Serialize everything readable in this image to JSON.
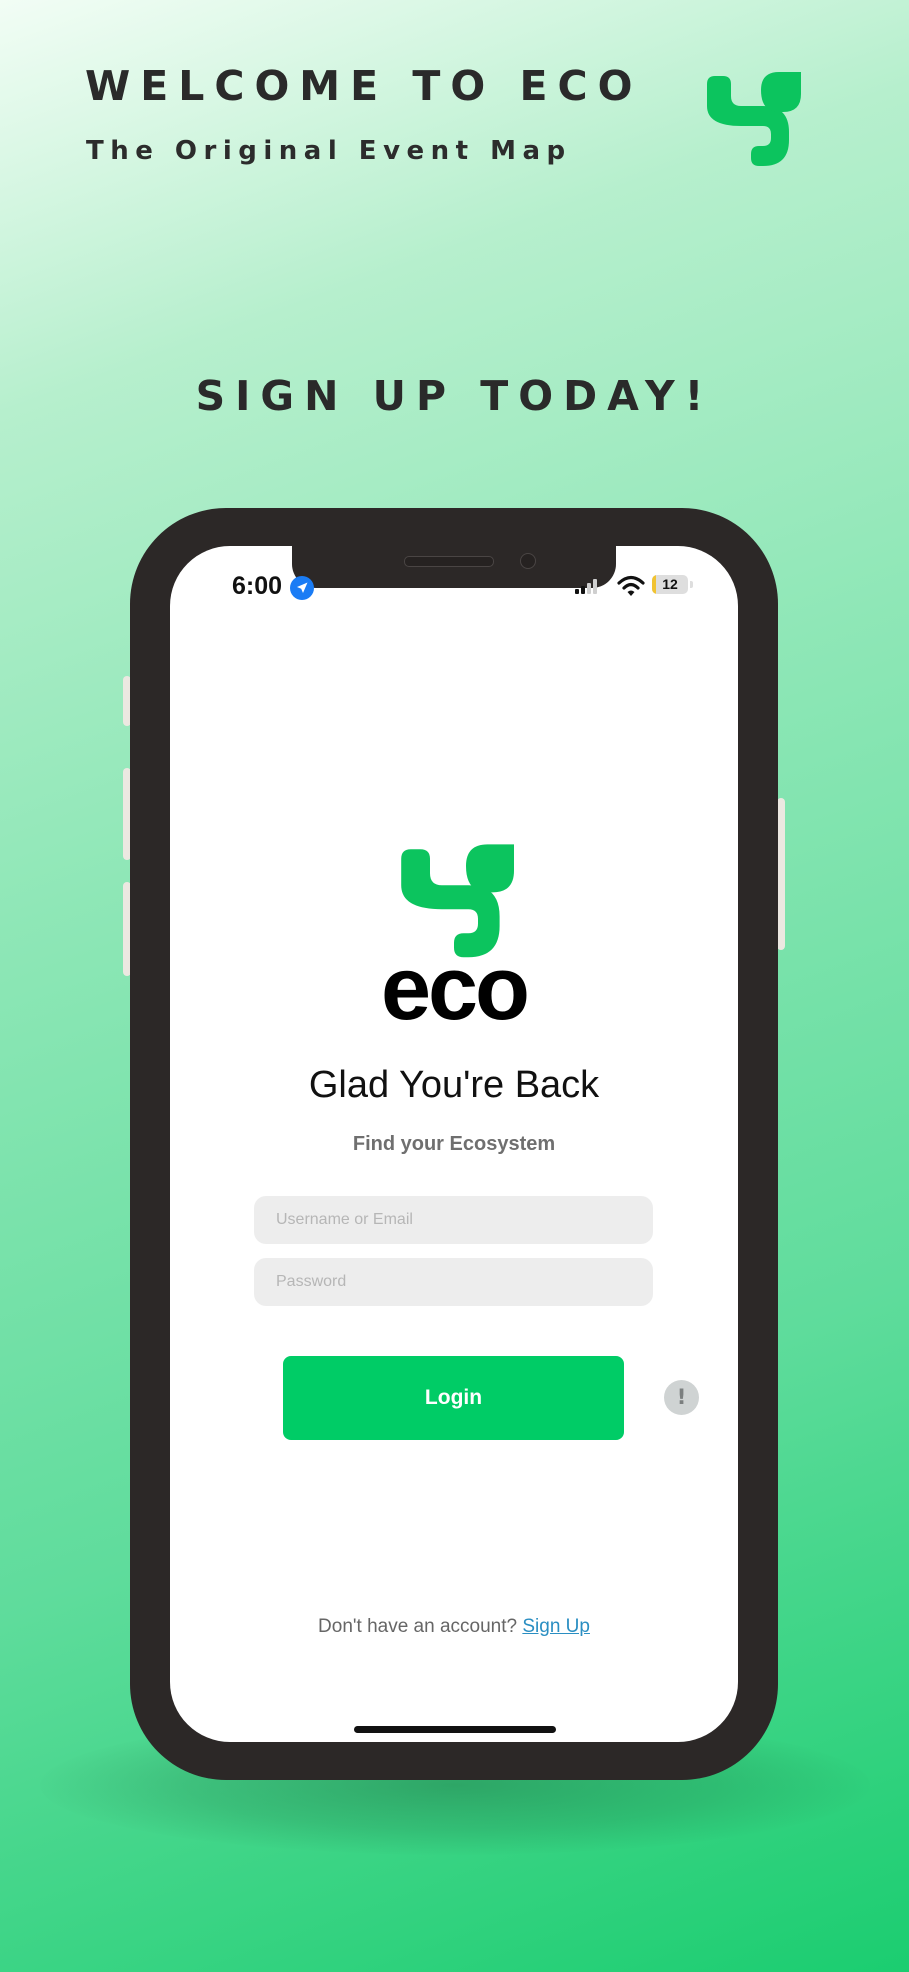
{
  "promo": {
    "title": "WELCOME TO ECO",
    "subtitle": "The Original Event Map",
    "cta": "SIGN UP TODAY!",
    "logo_icon": "eco-leaf-logo-icon"
  },
  "status_bar": {
    "time": "6:00",
    "battery": "12",
    "battery_level": 0.12,
    "icons": [
      "location-arrow-icon",
      "cellular-signal-icon",
      "wifi-icon",
      "battery-icon"
    ]
  },
  "login": {
    "brand": "eco",
    "greeting": "Glad You're Back",
    "subtitle": "Find your Ecosystem",
    "username_placeholder": "Username or Email",
    "username_value": "",
    "password_placeholder": "Password",
    "password_value": "",
    "login_label": "Login",
    "info_label": "!",
    "signup_prompt": "Don't have an account?",
    "signup_link": "Sign Up"
  },
  "colors": {
    "accent": "#00CC66",
    "logo_green": "#0CC45E",
    "phone_frame": "#2C2827",
    "field_bg": "#EDEDED",
    "link": "#2A8EC2",
    "info_bg": "#CFD3D3"
  }
}
